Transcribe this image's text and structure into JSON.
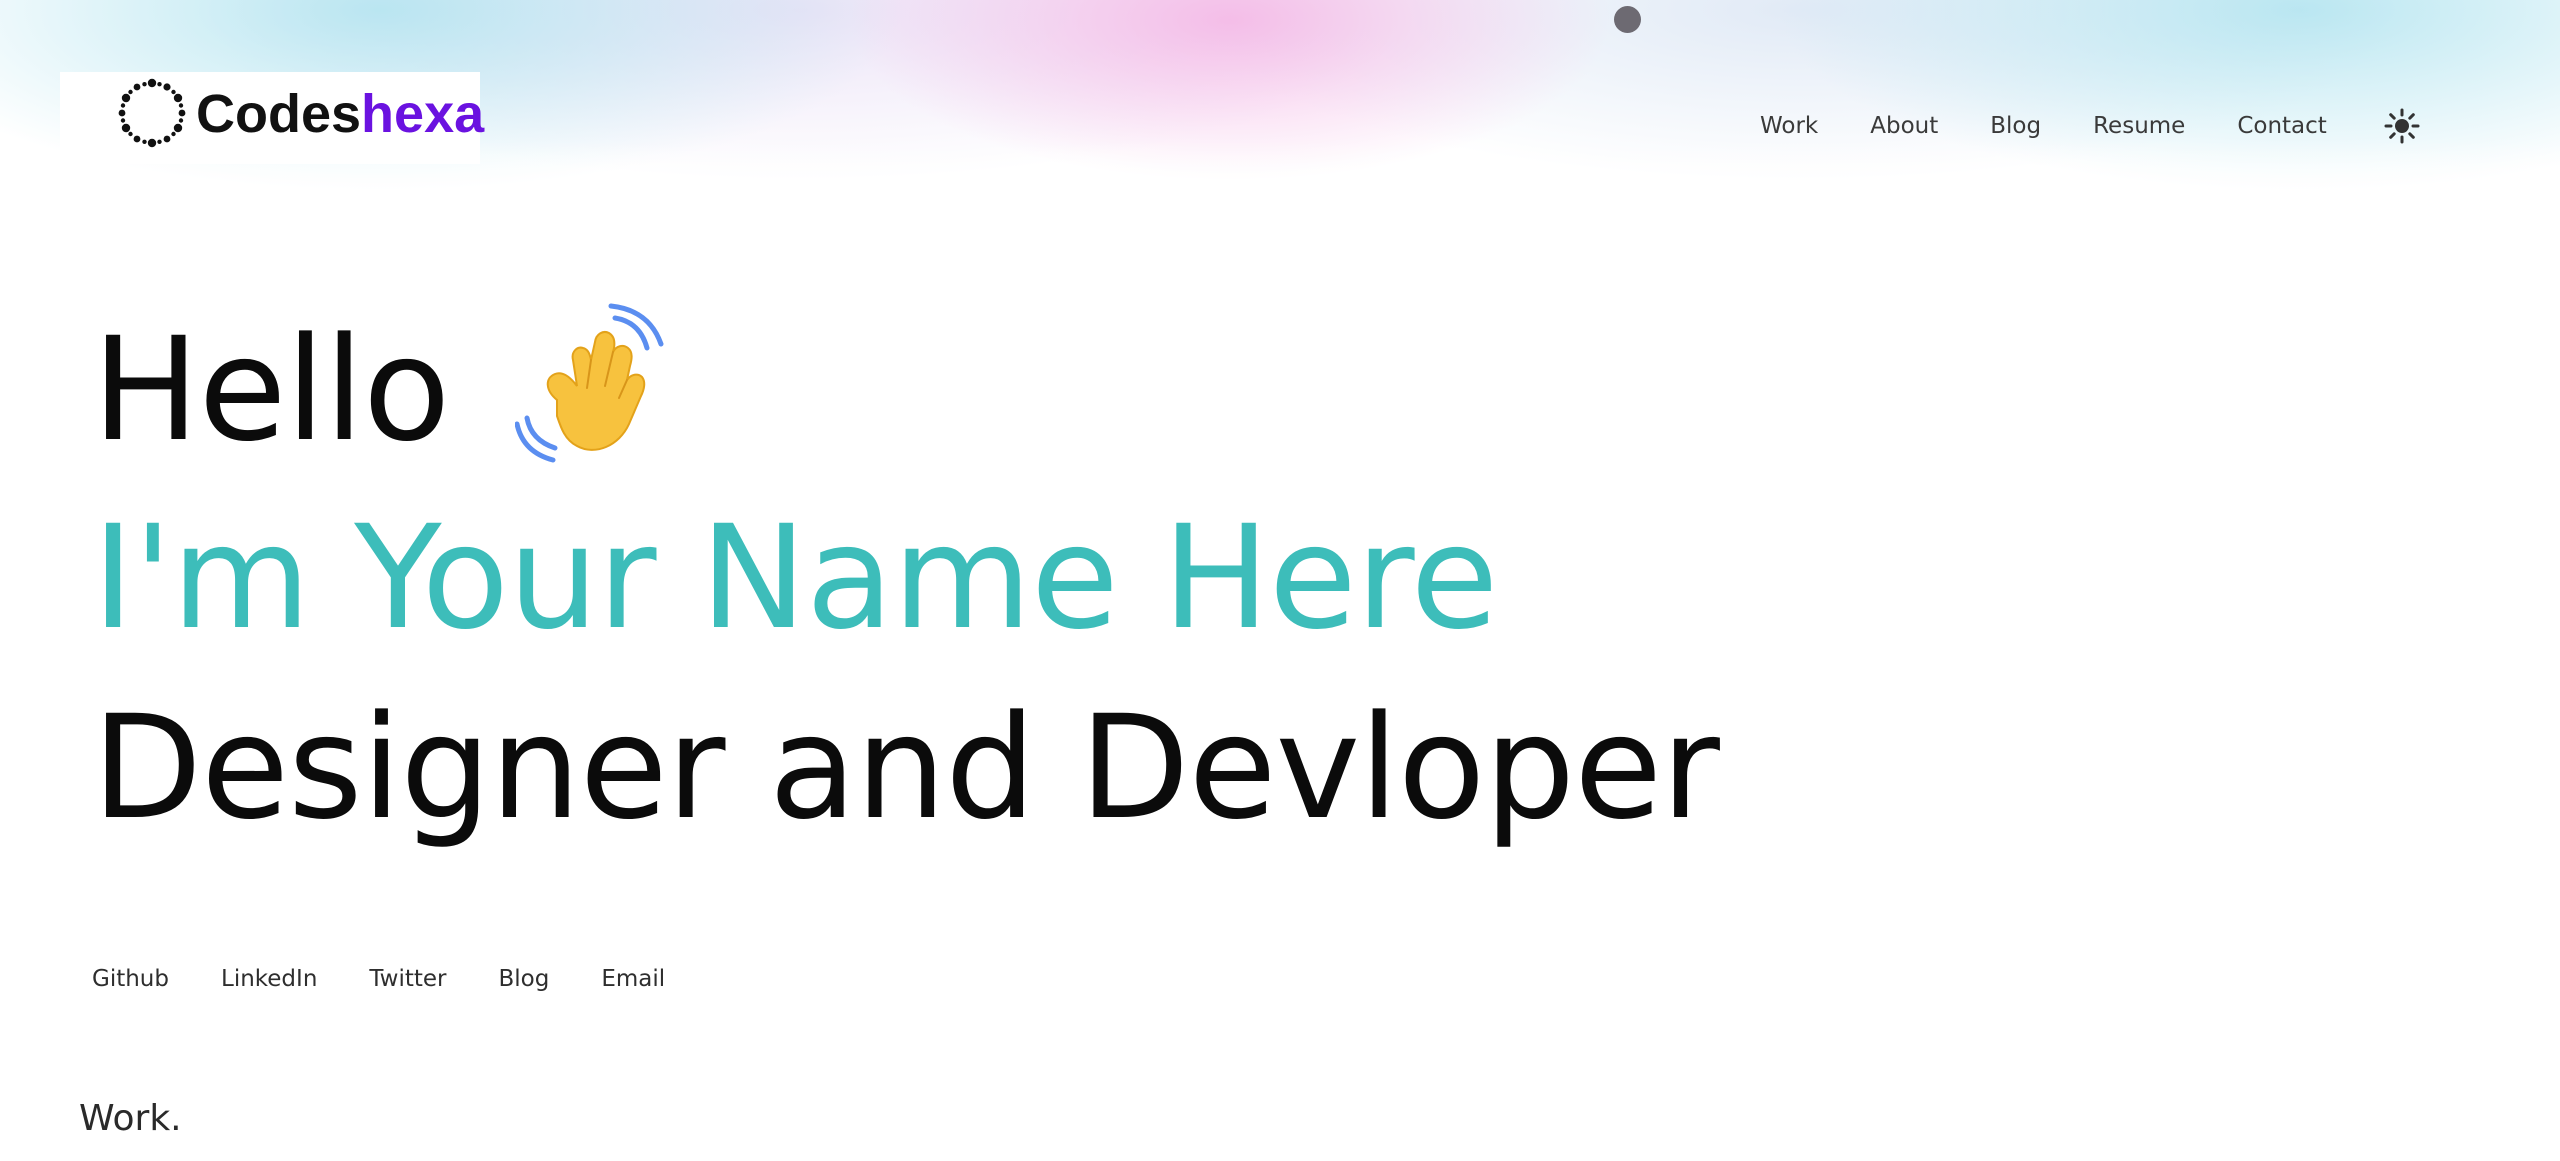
{
  "brand": {
    "logo_part_a": "Codes",
    "logo_part_b": "hexa",
    "logo_icon": "dotted-ring-icon",
    "accent_color": "#6a12e0"
  },
  "nav": {
    "items": [
      {
        "label": "Work"
      },
      {
        "label": "About"
      },
      {
        "label": "Blog"
      },
      {
        "label": "Resume"
      },
      {
        "label": "Contact"
      }
    ],
    "theme_toggle_icon": "sun-icon"
  },
  "hero": {
    "greeting": "Hello",
    "greeting_icon": "waving-hand-icon",
    "name": "I'm Your Name Here",
    "role": "Designer and Devloper",
    "name_color": "#3dbdba"
  },
  "social": {
    "links": [
      {
        "label": "Github"
      },
      {
        "label": "LinkedIn"
      },
      {
        "label": "Twitter"
      },
      {
        "label": "Blog"
      },
      {
        "label": "Email"
      }
    ]
  },
  "sections": {
    "work_title": "Work."
  }
}
